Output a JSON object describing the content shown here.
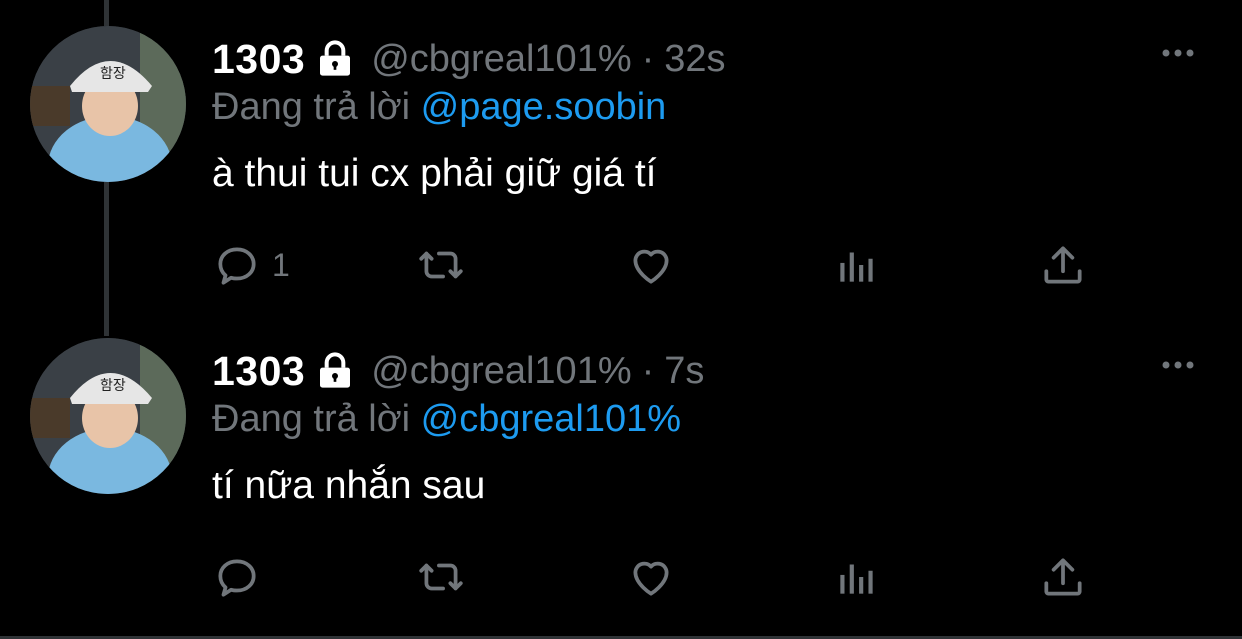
{
  "tweets": [
    {
      "display_name": "1303",
      "handle": "@cbgreal101%",
      "separator": "·",
      "time": "32s",
      "reply_prefix": "Đang trả lời",
      "reply_to": "@page.soobin",
      "text": "à thui tui cx phải giữ giá tí",
      "reply_count": "1",
      "retweet_count": "",
      "like_count": ""
    },
    {
      "display_name": "1303",
      "handle": "@cbgreal101%",
      "separator": "·",
      "time": "7s",
      "reply_prefix": "Đang trả lời",
      "reply_to": "@cbgreal101%",
      "text": "tí nữa nhắn sau",
      "reply_count": "",
      "retweet_count": "",
      "like_count": ""
    }
  ],
  "avatar_helmet_text": "함장",
  "icons": {
    "lock": "lock-icon",
    "more": "more-icon",
    "reply": "reply-icon",
    "retweet": "retweet-icon",
    "like": "heart-icon",
    "analytics": "analytics-icon",
    "share": "share-icon"
  },
  "colors": {
    "background": "#000000",
    "text": "#ffffff",
    "muted": "#71767b",
    "accent": "#1d9bf0",
    "divider": "#2f3336"
  }
}
